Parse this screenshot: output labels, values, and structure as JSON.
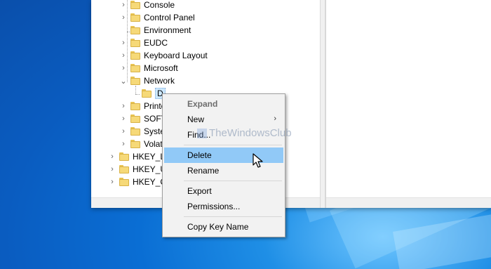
{
  "tree": {
    "nodes": [
      {
        "label": "Console",
        "chevron": "›"
      },
      {
        "label": "Control Panel",
        "chevron": "›"
      },
      {
        "label": "Environment",
        "chevron": ""
      },
      {
        "label": "EUDC",
        "chevron": "›"
      },
      {
        "label": "Keyboard Layout",
        "chevron": "›"
      },
      {
        "label": "Microsoft",
        "chevron": "›"
      },
      {
        "label": "Network",
        "chevron": "⌄"
      },
      {
        "label": "D",
        "chevron": ""
      },
      {
        "label": "Printe",
        "chevron": "›"
      },
      {
        "label": "SOFT",
        "chevron": "›"
      },
      {
        "label": "Syste",
        "chevron": "›"
      },
      {
        "label": "Volat",
        "chevron": "›"
      },
      {
        "label": "HKEY_LC",
        "chevron": "›"
      },
      {
        "label": "HKEY_U",
        "chevron": "›"
      },
      {
        "label": "HKEY_C",
        "chevron": "›"
      }
    ]
  },
  "context_menu": {
    "expand": "Expand",
    "new": "New",
    "find": "Find...",
    "delete": "Delete",
    "rename": "Rename",
    "export": "Export",
    "permissions": "Permissions...",
    "copy_key_name": "Copy Key Name",
    "submenu_arrow": "›"
  },
  "watermark": "TheWindowsClub",
  "colors": {
    "hover": "#91c9f7",
    "folder": "#f6d978",
    "desktop": "#0a6ed4"
  }
}
